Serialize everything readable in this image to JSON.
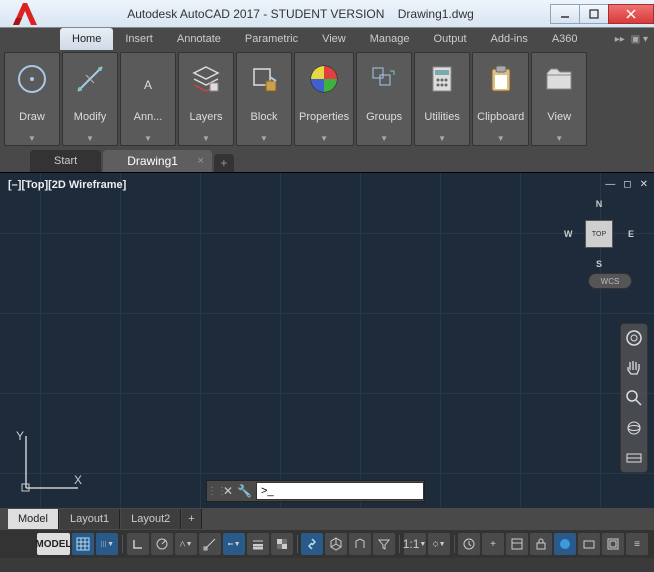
{
  "title": {
    "app": "Autodesk AutoCAD 2017 - STUDENT VERSION",
    "file": "Drawing1.dwg"
  },
  "menu": {
    "items": [
      "Home",
      "Insert",
      "Annotate",
      "Parametric",
      "View",
      "Manage",
      "Output",
      "Add-ins",
      "A360"
    ],
    "active": 0
  },
  "ribbon": [
    {
      "label": "Draw",
      "icon": "circle"
    },
    {
      "label": "Modify",
      "icon": "move"
    },
    {
      "label": "Ann...",
      "icon": "text-a"
    },
    {
      "label": "Layers",
      "icon": "layers"
    },
    {
      "label": "Block",
      "icon": "block"
    },
    {
      "label": "Properties",
      "icon": "palette"
    },
    {
      "label": "Groups",
      "icon": "group"
    },
    {
      "label": "Utilities",
      "icon": "calc"
    },
    {
      "label": "Clipboard",
      "icon": "clip"
    },
    {
      "label": "View",
      "icon": "folder"
    }
  ],
  "doctabs": {
    "items": [
      "Start",
      "Drawing1"
    ],
    "active": 1
  },
  "viewport": {
    "label": "[–][Top][2D Wireframe]",
    "wcs": "WCS",
    "cube": "TOP"
  },
  "compass": {
    "n": "N",
    "s": "S",
    "e": "E",
    "w": "W"
  },
  "cmdline": {
    "prompt": ">_"
  },
  "bottomtabs": {
    "items": [
      "Model",
      "Layout1",
      "Layout2"
    ],
    "active": 0
  },
  "status": {
    "model": "MODEL",
    "scale": "1:1"
  }
}
